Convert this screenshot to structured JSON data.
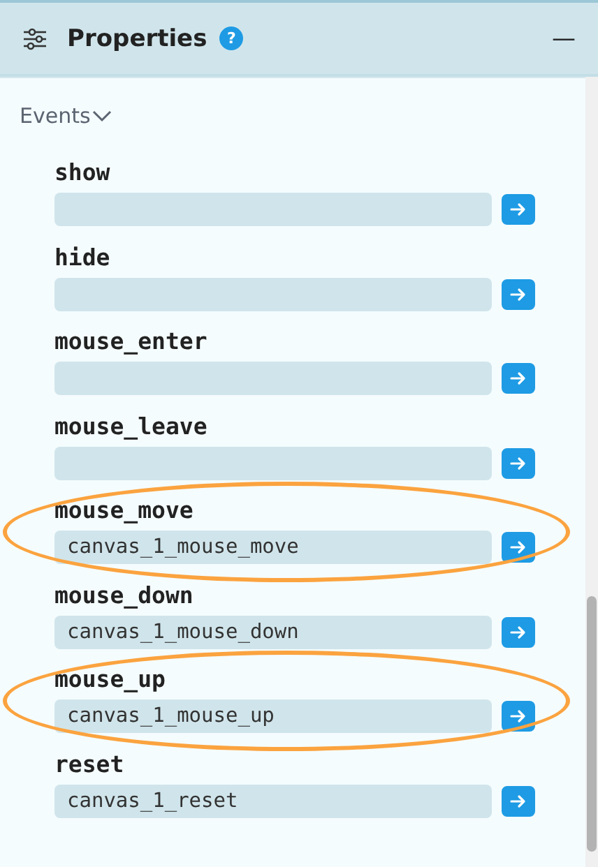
{
  "panel": {
    "title": "Properties",
    "help_icon": "?",
    "collapse_icon": "—"
  },
  "section": {
    "title": "Events",
    "expanded": true
  },
  "events": [
    {
      "name": "show",
      "highlighted": false
    },
    {
      "name": "hide",
      "highlighted": false
    },
    {
      "name": "mouse_enter",
      "highlighted": false
    },
    {
      "name": "mouse_leave",
      "highlighted": false
    },
    {
      "name": "mouse_move",
      "value": "canvas_1_mouse_move",
      "highlighted": true
    },
    {
      "name": "mouse_down",
      "value": "canvas_1_mouse_down",
      "highlighted": false
    },
    {
      "name": "mouse_up",
      "value": "canvas_1_mouse_up",
      "highlighted": true
    },
    {
      "name": "reset",
      "value": "canvas_1_reset",
      "highlighted": false
    }
  ]
}
